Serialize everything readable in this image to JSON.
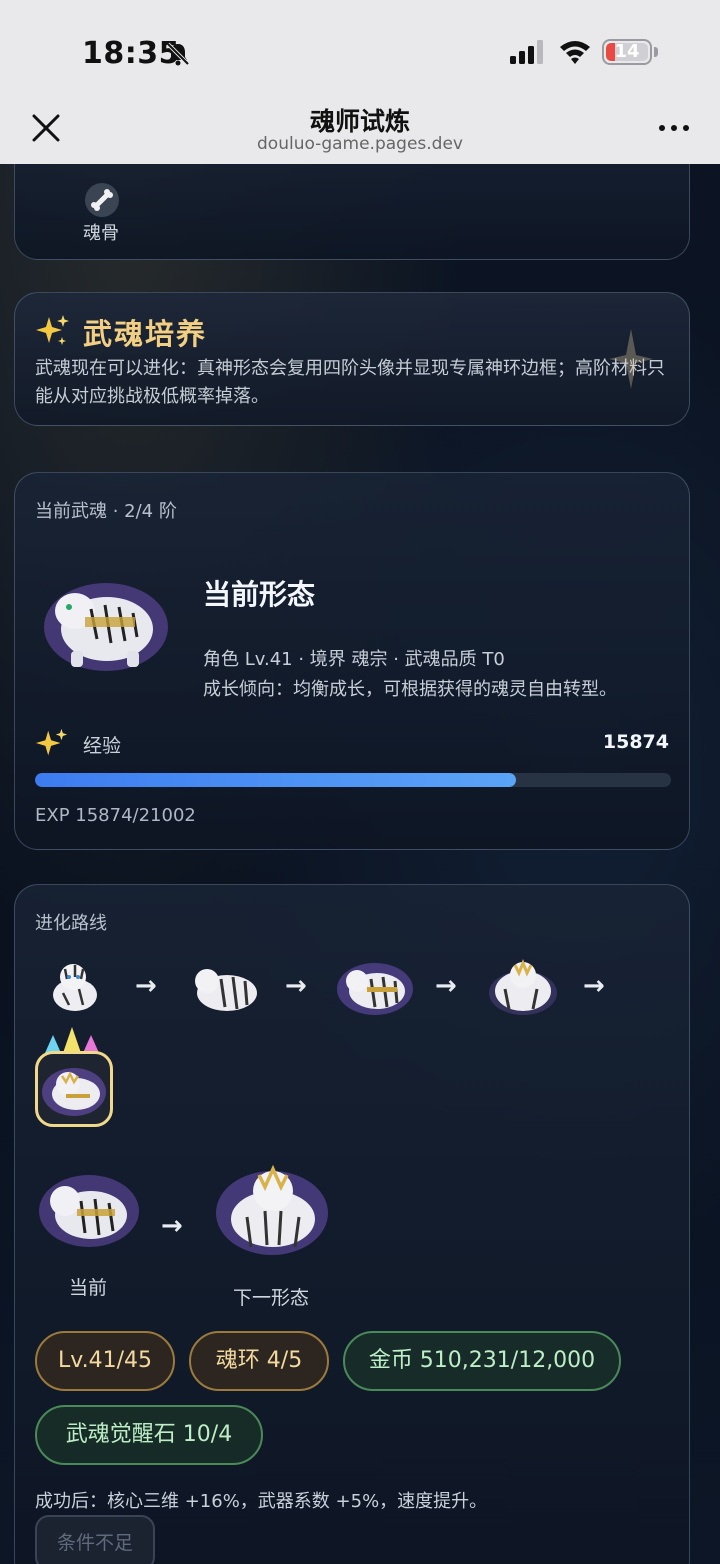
{
  "status_bar": {
    "time": "18:35",
    "battery": "14"
  },
  "browser": {
    "title": "魂师试炼",
    "url": "douluo-game.pages.dev"
  },
  "top_card": {
    "item_label": "魂骨"
  },
  "intro": {
    "title": "武魂培养",
    "text": "武魂现在可以进化：真神形态会复用四阶头像并显现专属神环边框；高阶材料只能从对应挑战极低概率掉落。"
  },
  "current_soul": {
    "section_label": "当前武魂 · 2/4 阶",
    "form_title": "当前形态",
    "meta": "角色 Lv.41 · 境界 魂宗 · 武魂品质 T0",
    "desc": "成长倾向：均衡成长，可根据获得的魂灵自由转型。",
    "exp_label": "经验",
    "exp_value": "15874",
    "exp_text": "EXP 15874/21002",
    "exp_progress": 0.7558
  },
  "evolution": {
    "section_label": "进化路线",
    "arrow": "→",
    "caption_current": "当前",
    "caption_next": "下一形态",
    "requirements": [
      {
        "label": "Lv.41/45",
        "kind": "gold"
      },
      {
        "label": "魂环 4/5",
        "kind": "gold"
      },
      {
        "label": "金币 510,231/12,000",
        "kind": "green"
      },
      {
        "label": "武魂觉醒石 10/4",
        "kind": "green"
      }
    ],
    "effect": "成功后：核心三维 +16%，武器系数 +5%，速度提升。",
    "button_label": "条件不足"
  },
  "colors": {
    "accent_blue": "#3d7cf0",
    "gold": "#f2cf83",
    "green_ok": "#bdeec6"
  }
}
